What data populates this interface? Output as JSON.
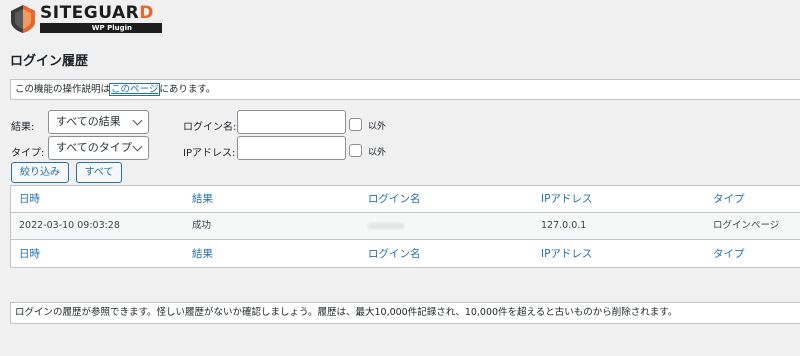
{
  "logo": {
    "name_main": "SITEGUAR",
    "name_accent": "D",
    "subtitle": "WP Plugin"
  },
  "page_title": "ログイン履歴",
  "notice_top": {
    "prefix": "この機能の操作説明は",
    "link": "このページ",
    "suffix": "にあります。"
  },
  "filter": {
    "result_label": "結果:",
    "result_value": "すべての結果",
    "type_label": "タイプ:",
    "type_value": "すべてのタイプ",
    "login_name_label": "ログイン名:",
    "ip_label": "IPアドレス:",
    "exclude_label": "以外",
    "filter_button": "絞り込み",
    "all_button": "すべて"
  },
  "table": {
    "columns": [
      "日時",
      "結果",
      "ログイン名",
      "IPアドレス",
      "タイプ"
    ],
    "rows": [
      [
        "2022-03-10 09:03:28",
        "成功",
        "",
        "127.0.0.1",
        "ログインページ"
      ]
    ]
  },
  "notice_bottom": "ログインの履歴が参照できます。怪しい履歴がないか確認しましょう。履歴は、最大10,000件記録され、10,000件を超えると古いものから削除されます。",
  "colors": {
    "accent": "#e8672a",
    "link": "#2271b1",
    "background": "#f0f0f1"
  }
}
